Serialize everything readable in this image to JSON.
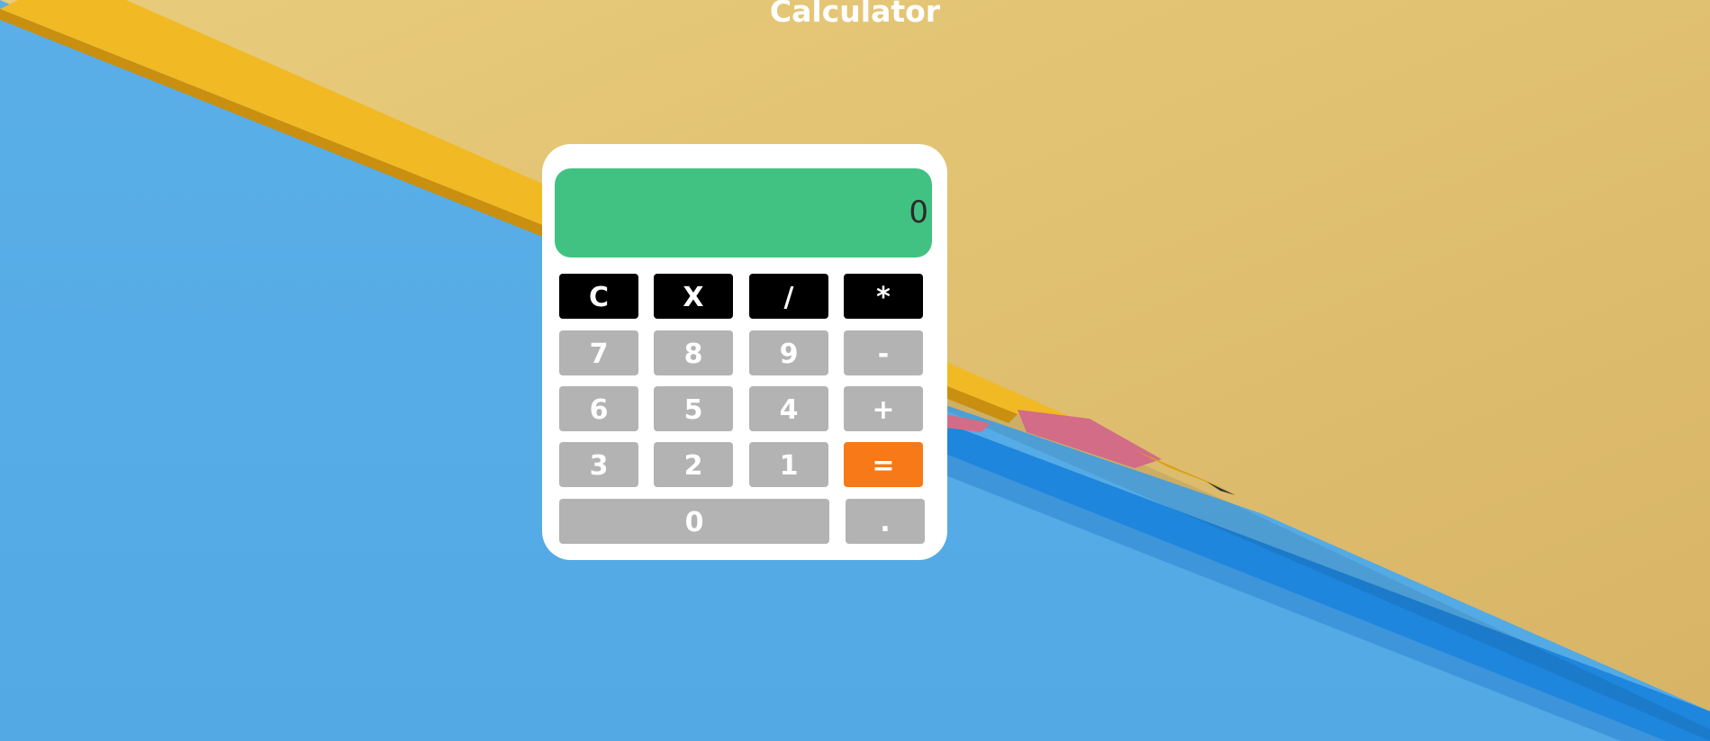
{
  "page": {
    "title": "Calculator"
  },
  "calculator": {
    "display": "0",
    "keys": {
      "clear": "C",
      "delete": "X",
      "divide": "/",
      "multiply": "*",
      "seven": "7",
      "eight": "8",
      "nine": "9",
      "minus": "-",
      "six": "6",
      "five": "5",
      "four": "4",
      "plus": "+",
      "three": "3",
      "two": "2",
      "one": "1",
      "equals": "=",
      "zero": "0",
      "decimal": "."
    }
  },
  "colors": {
    "display_bg": "#42c282",
    "operator_key": "#000000",
    "number_key": "#b3b3b3",
    "equals_key": "#f77918",
    "panel": "#ffffff"
  }
}
